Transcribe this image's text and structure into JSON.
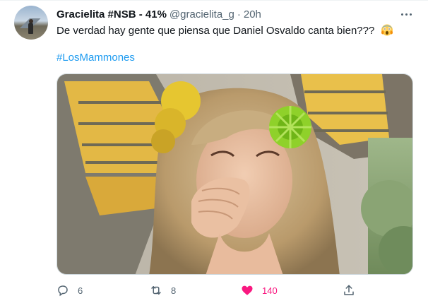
{
  "tweet": {
    "author_name": "Gracielita #NSB - 41%",
    "handle": "@gracielita_g",
    "separator": "·",
    "time": "20h",
    "text": "De verdad hay gente que piensa que Daniel Osvaldo canta bien???",
    "emoji": "face-screaming-in-fear",
    "hashtag": "#LosMammones"
  },
  "actions": {
    "replies": "6",
    "retweets": "8",
    "likes": "140",
    "liked": true
  },
  "colors": {
    "link": "#1d9bf0",
    "like": "#f91880",
    "muted": "#536471",
    "text": "#0f1419"
  },
  "icons": [
    "more-options-icon",
    "reply-icon",
    "retweet-icon",
    "heart-icon",
    "share-icon"
  ]
}
